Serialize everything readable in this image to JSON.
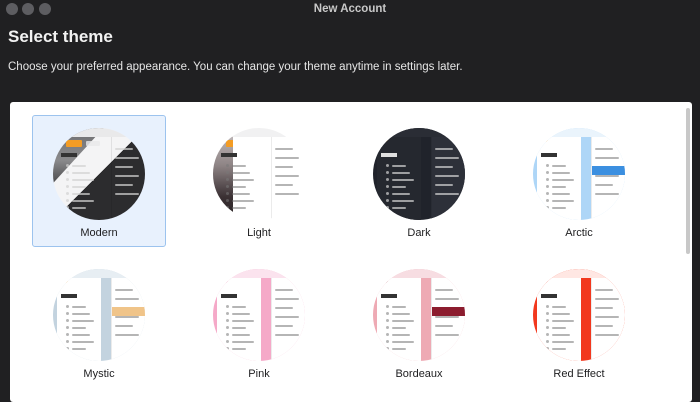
{
  "window": {
    "title": "New Account"
  },
  "heading": "Select theme",
  "subtitle": "Choose your preferred appearance. You can change your theme anytime in settings later.",
  "themes": [
    {
      "label": "Modern",
      "selected": true,
      "kind": "modern",
      "colors": {
        "bg": "#3d3d3f",
        "bar": "#e9e9ea",
        "accent": "#f39c24",
        "list": "#2b2b2d",
        "text": "#dcdcdc"
      }
    },
    {
      "label": "Light",
      "selected": false,
      "kind": "photo",
      "colors": {
        "bg": "#ffffff",
        "bar": "#f1f1f2",
        "accent": "#f39c24",
        "list": "#ffffff",
        "text": "#555555",
        "photo": "#5a4f52"
      }
    },
    {
      "label": "Dark",
      "selected": false,
      "kind": "solid",
      "colors": {
        "bg": "#20232b",
        "bar": "#2a2d35",
        "accent": "#f39c24",
        "list": "#2b2e36",
        "text": "#c8c8c8"
      }
    },
    {
      "label": "Arctic",
      "selected": false,
      "kind": "solid",
      "colors": {
        "bg": "#aed6f7",
        "bar": "#eaf4fc",
        "accent": "#f39c24",
        "list": "#ffffff",
        "text": "#5a6a7a",
        "hl": "#3b8fe0"
      }
    },
    {
      "label": "Mystic",
      "selected": false,
      "kind": "solid",
      "colors": {
        "bg": "#c3d3df",
        "bar": "#e7eef3",
        "accent": "#f39c24",
        "list": "#ffffff",
        "text": "#5a6a7a",
        "hl": "#f0c489"
      }
    },
    {
      "label": "Pink",
      "selected": false,
      "kind": "solid",
      "colors": {
        "bg": "#f5a9c8",
        "bar": "#fbe3ee",
        "accent": "#e0457f",
        "list": "#ffffff",
        "text": "#8a5a6a"
      }
    },
    {
      "label": "Bordeaux",
      "selected": false,
      "kind": "solid",
      "colors": {
        "bg": "#eeaab4",
        "bar": "#f7dde2",
        "accent": "#8c1c2e",
        "list": "#ffffff",
        "text": "#7a5a60",
        "hl": "#8c1c2e"
      }
    },
    {
      "label": "Red Effect",
      "selected": false,
      "kind": "solid",
      "colors": {
        "bg": "#f2381e",
        "bar": "#ffe7e3",
        "accent": "#e5301a",
        "list": "#ffffff",
        "text": "#6a5a58"
      }
    }
  ]
}
